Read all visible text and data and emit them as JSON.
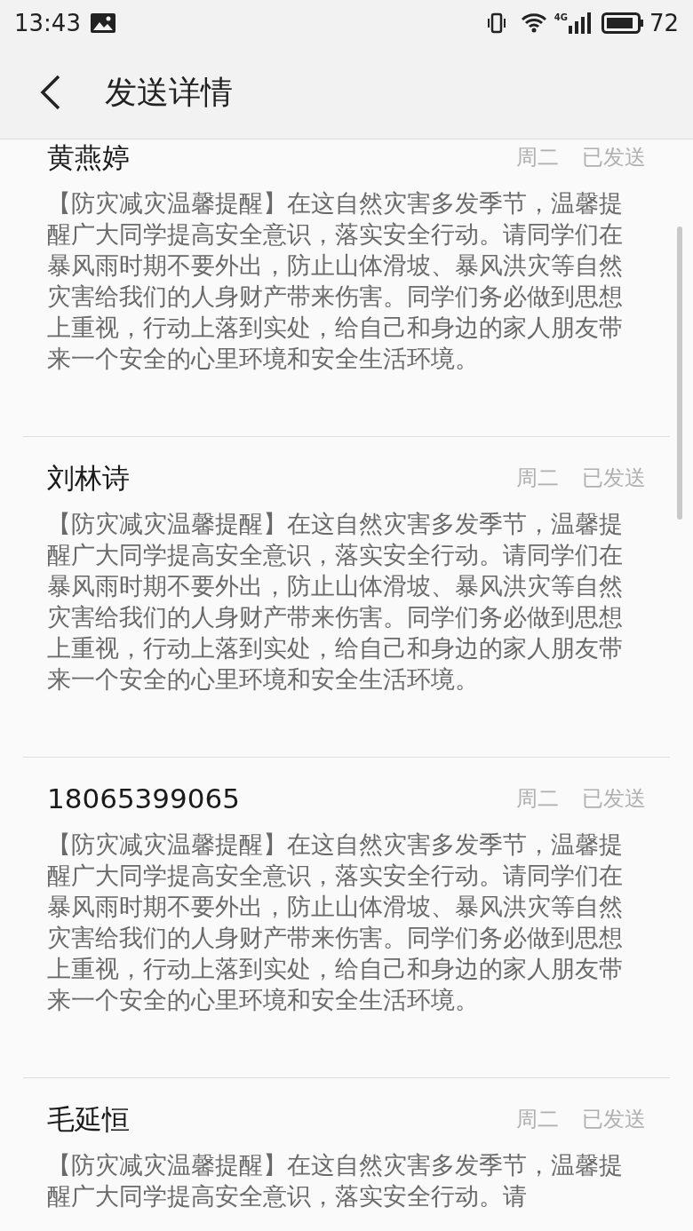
{
  "status_bar": {
    "time": "13:43",
    "network": "4G",
    "battery": "72"
  },
  "header": {
    "title": "发送详情"
  },
  "messages": [
    {
      "recipient": "黄燕婷",
      "day": "周二",
      "status": "已发送",
      "body": "【防灾减灾温馨提醒】在这自然灾害多发季节，温馨提醒广大同学提高安全意识，落实安全行动。请同学们在暴风雨时期不要外出，防止山体滑坡、暴风洪灾等自然灾害给我们的人身财产带来伤害。同学们务必做到思想上重视，行动上落到实处，给自己和身边的家人朋友带来一个安全的心里环境和安全生活环境。"
    },
    {
      "recipient": "刘林诗",
      "day": "周二",
      "status": "已发送",
      "body": "【防灾减灾温馨提醒】在这自然灾害多发季节，温馨提醒广大同学提高安全意识，落实安全行动。请同学们在暴风雨时期不要外出，防止山体滑坡、暴风洪灾等自然灾害给我们的人身财产带来伤害。同学们务必做到思想上重视，行动上落到实处，给自己和身边的家人朋友带来一个安全的心里环境和安全生活环境。"
    },
    {
      "recipient": "18065399065",
      "day": "周二",
      "status": "已发送",
      "body": "【防灾减灾温馨提醒】在这自然灾害多发季节，温馨提醒广大同学提高安全意识，落实安全行动。请同学们在暴风雨时期不要外出，防止山体滑坡、暴风洪灾等自然灾害给我们的人身财产带来伤害。同学们务必做到思想上重视，行动上落到实处，给自己和身边的家人朋友带来一个安全的心里环境和安全生活环境。"
    },
    {
      "recipient": "毛延恒",
      "day": "周二",
      "status": "已发送",
      "body": "【防灾减灾温馨提醒】在这自然灾害多发季节，温馨提醒广大同学提高安全意识，落实安全行动。请"
    }
  ]
}
